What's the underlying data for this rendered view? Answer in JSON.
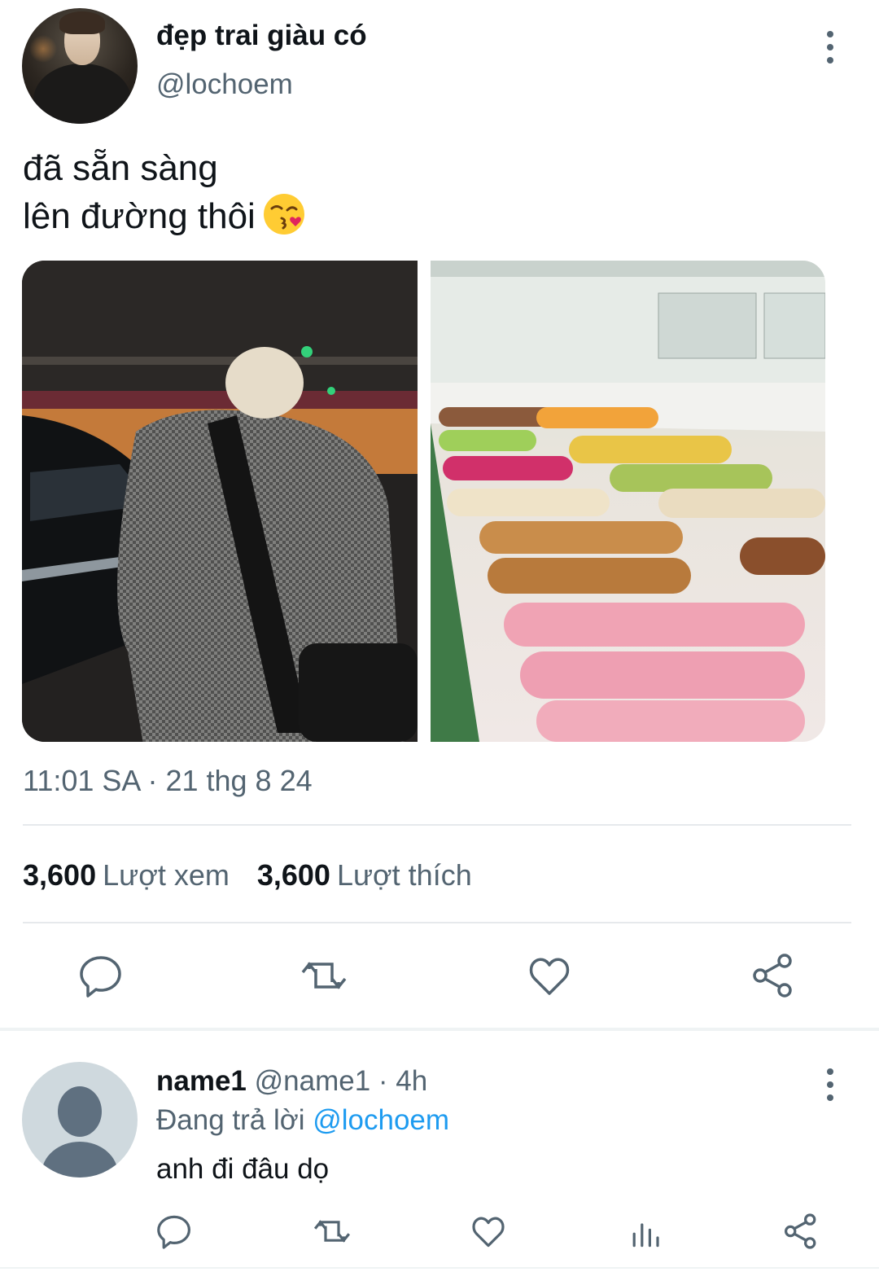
{
  "tweet": {
    "display_name": "đẹp trai giàu có",
    "handle": "@lochoem",
    "text_line1": "đã sẵn sàng",
    "text_line2": "lên đường thôi",
    "emoji_icon": "kissing-face-emoji-icon",
    "timestamp": "11:01 SA · 21 thg 8 24",
    "stats": {
      "views_count": "3,600",
      "views_label": "Lượt xem",
      "likes_count": "3,600",
      "likes_label": "Lượt thích"
    },
    "actions": [
      "reply-icon",
      "retweet-icon",
      "like-icon",
      "share-icon"
    ]
  },
  "reply": {
    "name": "name1",
    "meta": "@name1 · 4h",
    "replying_label": "Đang trả lời",
    "replying_to": "@lochoem",
    "text": "anh đi đâu dọ",
    "actions": [
      "reply-icon",
      "retweet-icon",
      "like-icon",
      "views-icon",
      "share-icon"
    ]
  },
  "colors": {
    "primary_text": "#0f1419",
    "secondary_text": "#536471",
    "link": "#1d9bf0",
    "divider": "#e6e9ec"
  }
}
